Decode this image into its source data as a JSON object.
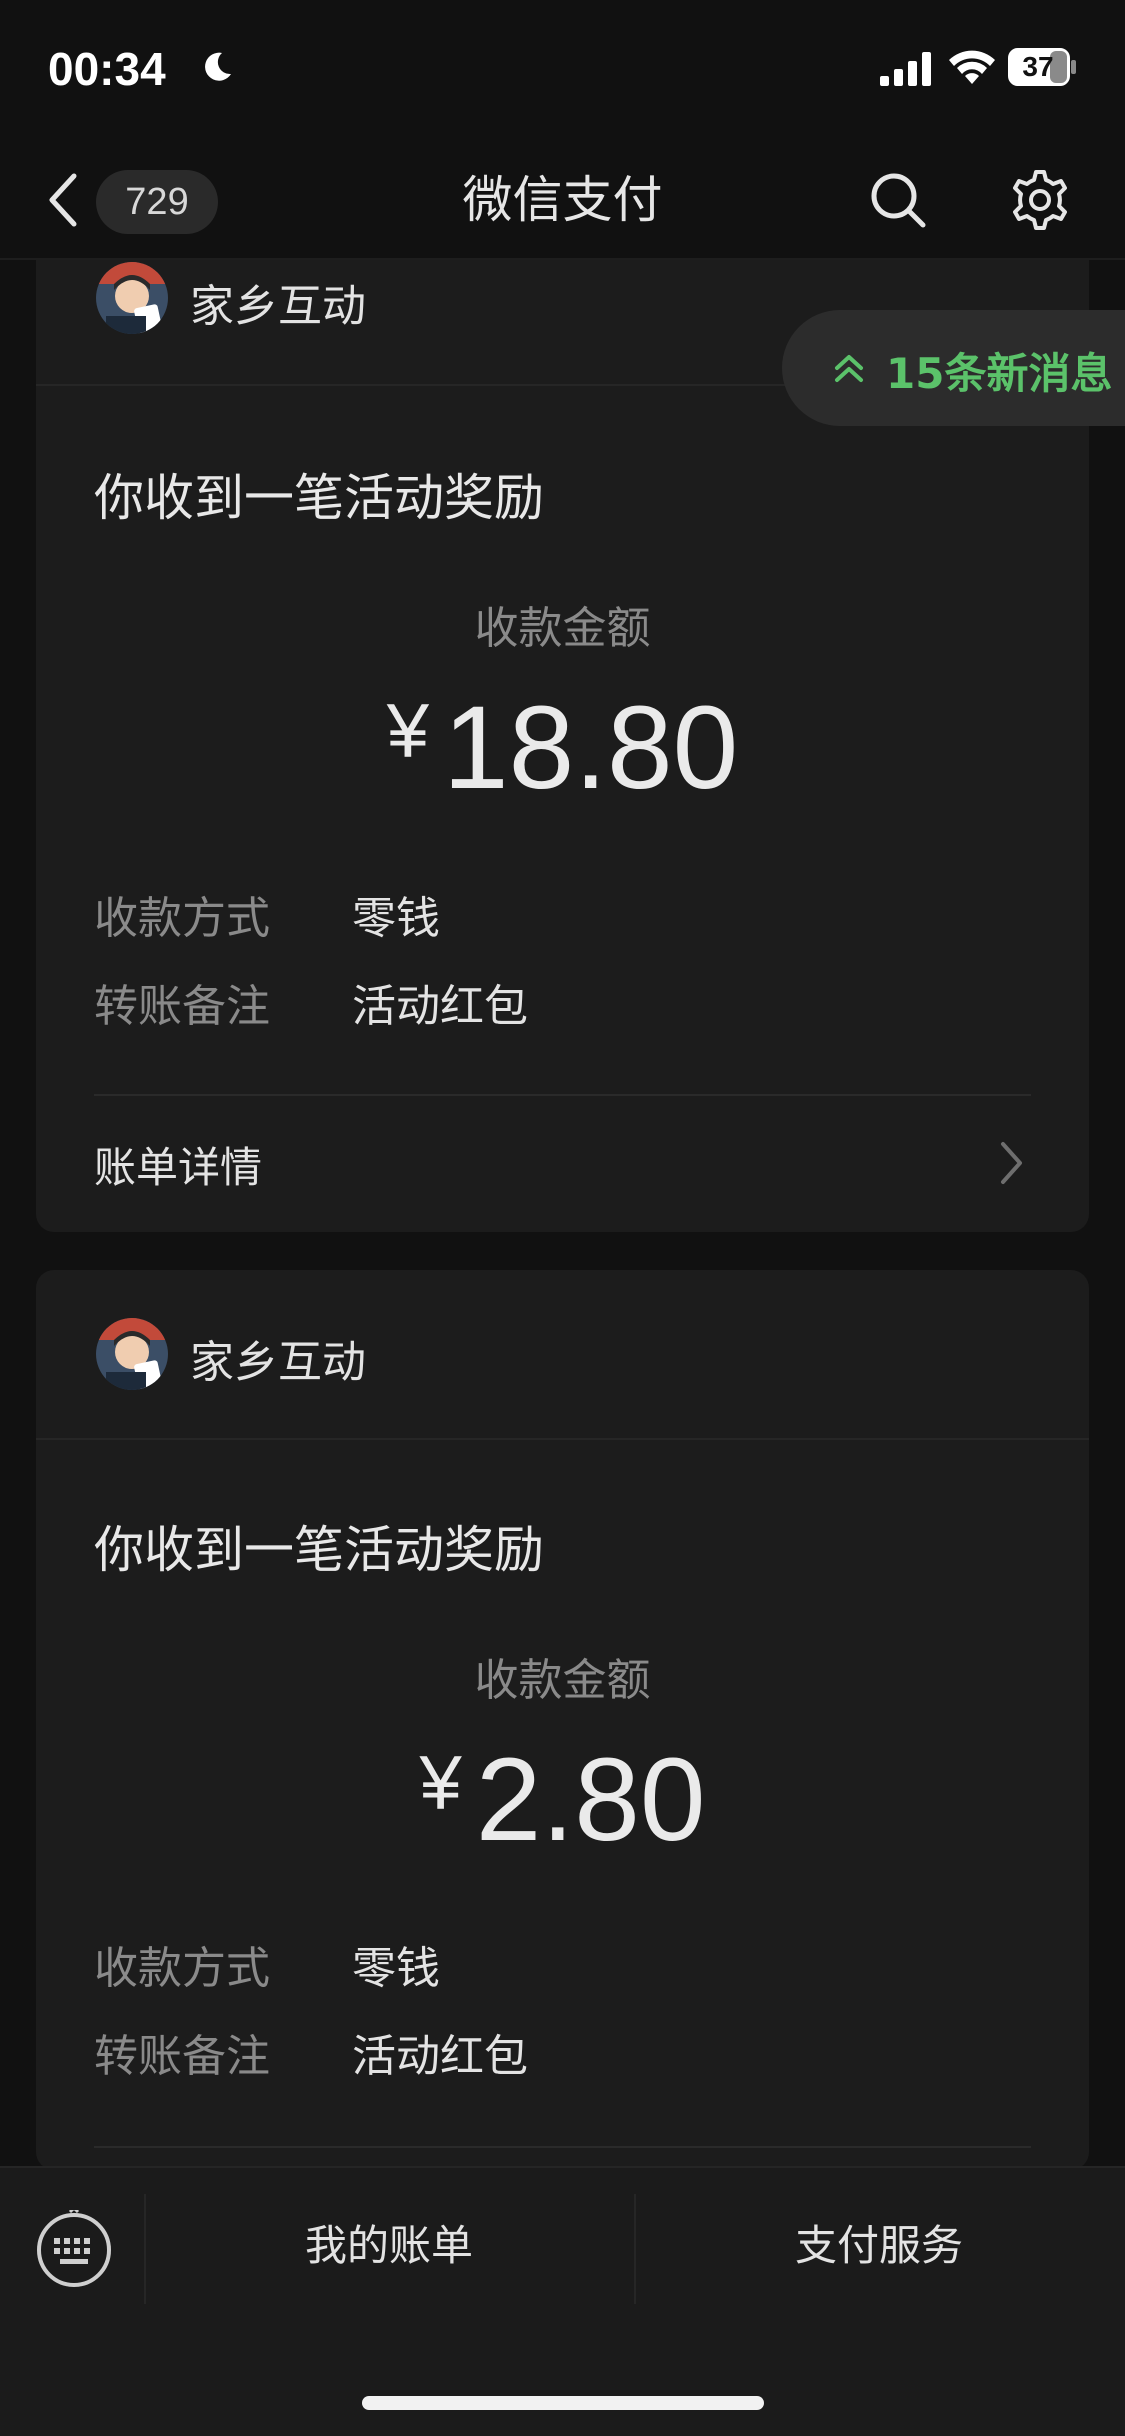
{
  "status_bar": {
    "time": "00:34",
    "battery": "37"
  },
  "nav": {
    "badge": "729",
    "title": "微信支付"
  },
  "new_messages": "15条新消息",
  "cards": [
    {
      "sender": "家乡互动",
      "title": "你收到一笔活动奖励",
      "amount_label": "收款金额",
      "currency": "¥",
      "amount": "18.80",
      "rows": [
        {
          "label": "收款方式",
          "value": "零钱"
        },
        {
          "label": "转账备注",
          "value": "活动红包"
        }
      ],
      "details_link": "账单详情"
    },
    {
      "sender": "家乡互动",
      "title": "你收到一笔活动奖励",
      "amount_label": "收款金额",
      "currency": "¥",
      "amount": "2.80",
      "rows": [
        {
          "label": "收款方式",
          "value": "零钱"
        },
        {
          "label": "转账备注",
          "value": "活动红包"
        }
      ]
    }
  ],
  "bottom_bar": {
    "bill_tab": "我的账单",
    "service_tab": "支付服务"
  },
  "colors": {
    "background": "#111111",
    "card": "#1c1c1c",
    "accent_green": "#5bc26a",
    "muted_text": "#8a8a8a"
  }
}
